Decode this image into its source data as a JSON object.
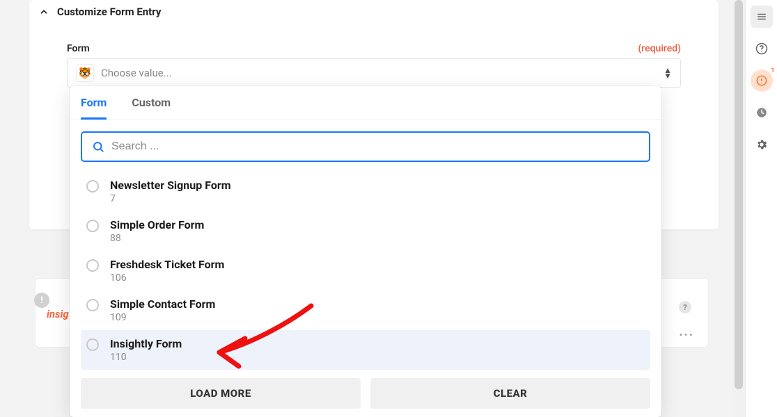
{
  "section": {
    "title": "Customize Form Entry"
  },
  "field": {
    "label": "Form",
    "required_text": "(required)",
    "placeholder": "Choose value...",
    "icon_emoji": "🐯"
  },
  "dropdown": {
    "tabs": [
      {
        "label": "Form",
        "active": true
      },
      {
        "label": "Custom",
        "active": false
      }
    ],
    "search_placeholder": "Search ...",
    "options": [
      {
        "label": "Newsletter Signup Form",
        "id": "7",
        "highlight": false
      },
      {
        "label": "Simple Order Form",
        "id": "88",
        "highlight": false
      },
      {
        "label": "Freshdesk Ticket Form",
        "id": "106",
        "highlight": false
      },
      {
        "label": "Simple Contact Form",
        "id": "109",
        "highlight": false
      },
      {
        "label": "Insightly Form",
        "id": "110",
        "highlight": true
      }
    ],
    "buttons": {
      "load_more": "LOAD MORE",
      "clear": "CLEAR"
    }
  },
  "back_card": {
    "brand_partial": "insig",
    "more_label": "..."
  },
  "rail": {
    "alert_badge": "1"
  }
}
